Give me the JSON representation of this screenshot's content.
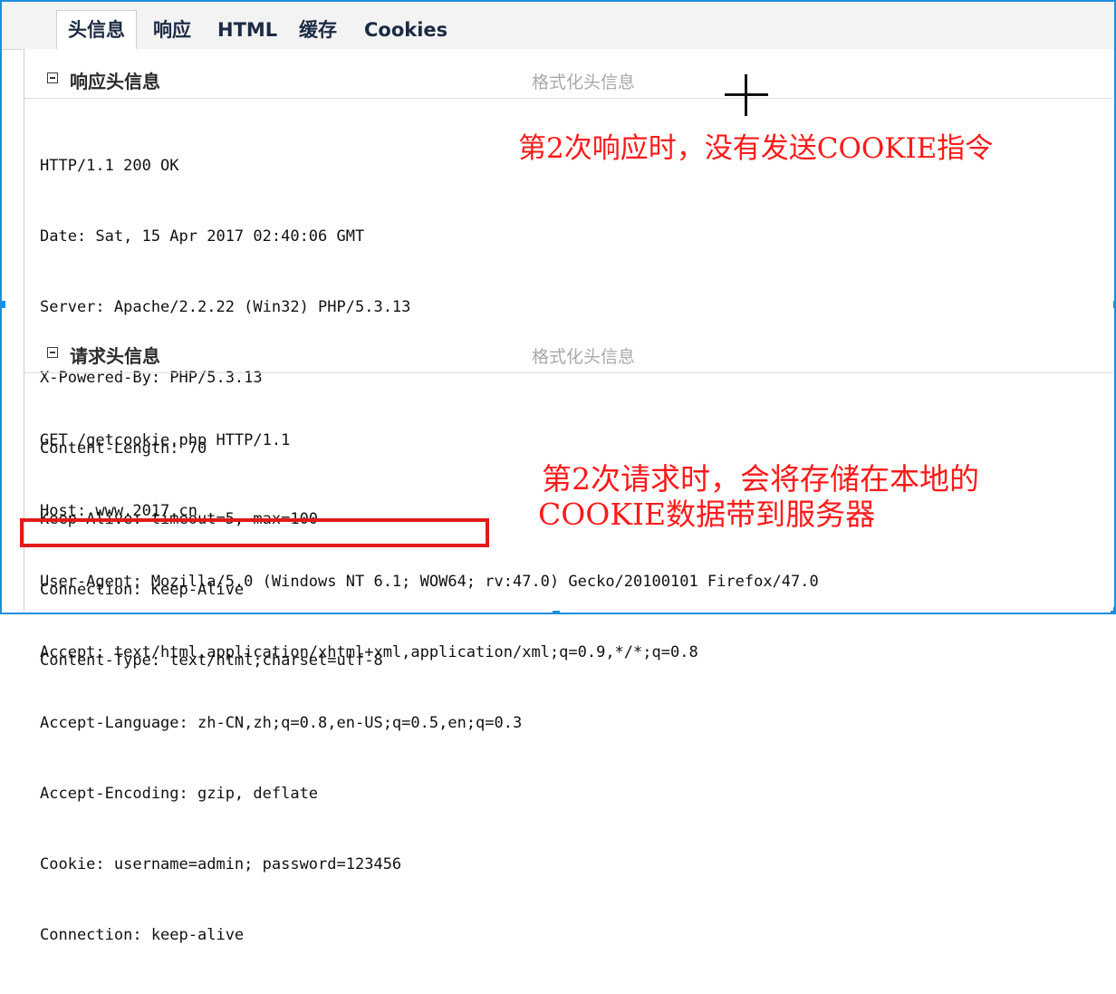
{
  "tabs": [
    {
      "label": "头信息",
      "active": true
    },
    {
      "label": "响应",
      "active": false
    },
    {
      "label": "HTML",
      "active": false
    },
    {
      "label": "缓存",
      "active": false
    },
    {
      "label": "Cookies",
      "active": false
    }
  ],
  "response_headers": {
    "title": "响应头信息",
    "format_link": "格式化头信息",
    "lines": [
      "HTTP/1.1 200 OK",
      "Date: Sat, 15 Apr 2017 02:40:06 GMT",
      "Server: Apache/2.2.22 (Win32) PHP/5.3.13",
      "X-Powered-By: PHP/5.3.13",
      "Content-Length: 70",
      "Keep-Alive: timeout=5, max=100",
      "Connection: Keep-Alive",
      "Content-Type: text/html;charset=utf-8"
    ]
  },
  "request_headers": {
    "title": "请求头信息",
    "format_link": "格式化头信息",
    "lines": [
      "GET /getcookie.php HTTP/1.1",
      "Host: www.2017.cn",
      "User-Agent: Mozilla/5.0 (Windows NT 6.1; WOW64; rv:47.0) Gecko/20100101 Firefox/47.0",
      "Accept: text/html,application/xhtml+xml,application/xml;q=0.9,*/*;q=0.8",
      "Accept-Language: zh-CN,zh;q=0.8,en-US;q=0.5,en;q=0.3",
      "Accept-Encoding: gzip, deflate",
      "Cookie: username=admin; password=123456",
      "Connection: keep-alive"
    ]
  },
  "annotations": {
    "response_note": "第2次响应时，没有发送COOKIE指令",
    "request_note_line1": "第2次请求时，会将存储在本地的",
    "request_note_line2": "COOKIE数据带到服务器"
  },
  "colors": {
    "annotation": "#ff1a1a",
    "highlight_box": "#e31a1a",
    "selection_frame": "#1a8fe0"
  }
}
